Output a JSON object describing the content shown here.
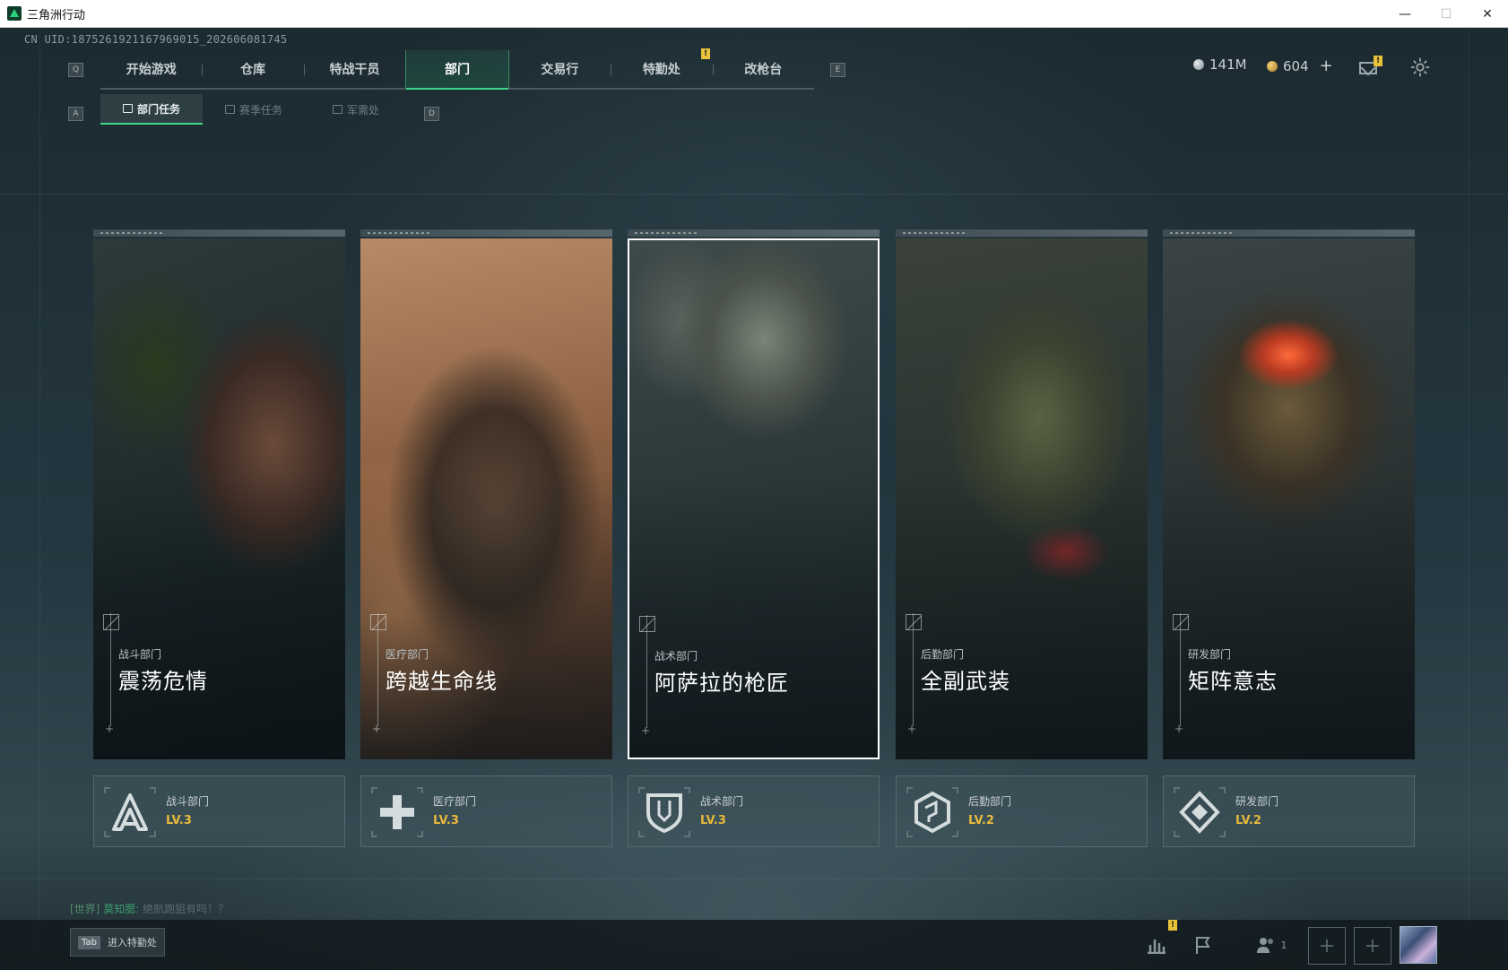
{
  "window": {
    "title": "三角洲行动",
    "controls": {
      "minimize": "—",
      "maximize": "☐",
      "close": "✕"
    }
  },
  "uid": "CN UID:1875261921167969015_202606081745",
  "nav": {
    "left_key": "Q",
    "right_key": "E",
    "tabs": [
      {
        "label": "开始游戏"
      },
      {
        "label": "仓库"
      },
      {
        "label": "特战干员"
      },
      {
        "label": "部门",
        "active": true
      },
      {
        "label": "交易行"
      },
      {
        "label": "特勤处",
        "badge": "!"
      },
      {
        "label": "改枪台"
      }
    ]
  },
  "subnav": {
    "left_key": "A",
    "right_key": "D",
    "tabs": [
      {
        "label": "部门任务",
        "active": true
      },
      {
        "label": "赛季任务"
      },
      {
        "label": "军需处"
      }
    ]
  },
  "currency": {
    "silver": "141M",
    "gold": "604",
    "plus": "+",
    "mail_badge": "!"
  },
  "cards": [
    {
      "subtitle": "战斗部门",
      "title": "震荡危情"
    },
    {
      "subtitle": "医疗部门",
      "title": "跨越生命线"
    },
    {
      "subtitle": "战术部门",
      "title": "阿萨拉的枪匠",
      "selected": true
    },
    {
      "subtitle": "后勤部门",
      "title": "全副武装"
    },
    {
      "subtitle": "研发部门",
      "title": "矩阵意志"
    }
  ],
  "departments": [
    {
      "name": "战斗部门",
      "level": "LV.3",
      "icon": "combat-dept-icon"
    },
    {
      "name": "医疗部门",
      "level": "LV.3",
      "icon": "medical-cross-icon"
    },
    {
      "name": "战术部门",
      "level": "LV.3",
      "icon": "tactical-shield-icon"
    },
    {
      "name": "后勤部门",
      "level": "LV.2",
      "icon": "logistics-hex-icon"
    },
    {
      "name": "研发部门",
      "level": "LV.2",
      "icon": "research-diamond-icon"
    }
  ],
  "chat": {
    "channel": "[世界]",
    "sender": "莫知腮:",
    "message": "绝航跑狙有吗！？"
  },
  "bottom": {
    "tab_key": "Tab",
    "tab_label": "进入特勤处",
    "stats_badge": "!",
    "team_count": "1",
    "slot_plus": "+"
  },
  "colors": {
    "accent_green": "#3bd489",
    "level_gold": "#e9b93c",
    "badge_yellow": "#e8c33a"
  }
}
